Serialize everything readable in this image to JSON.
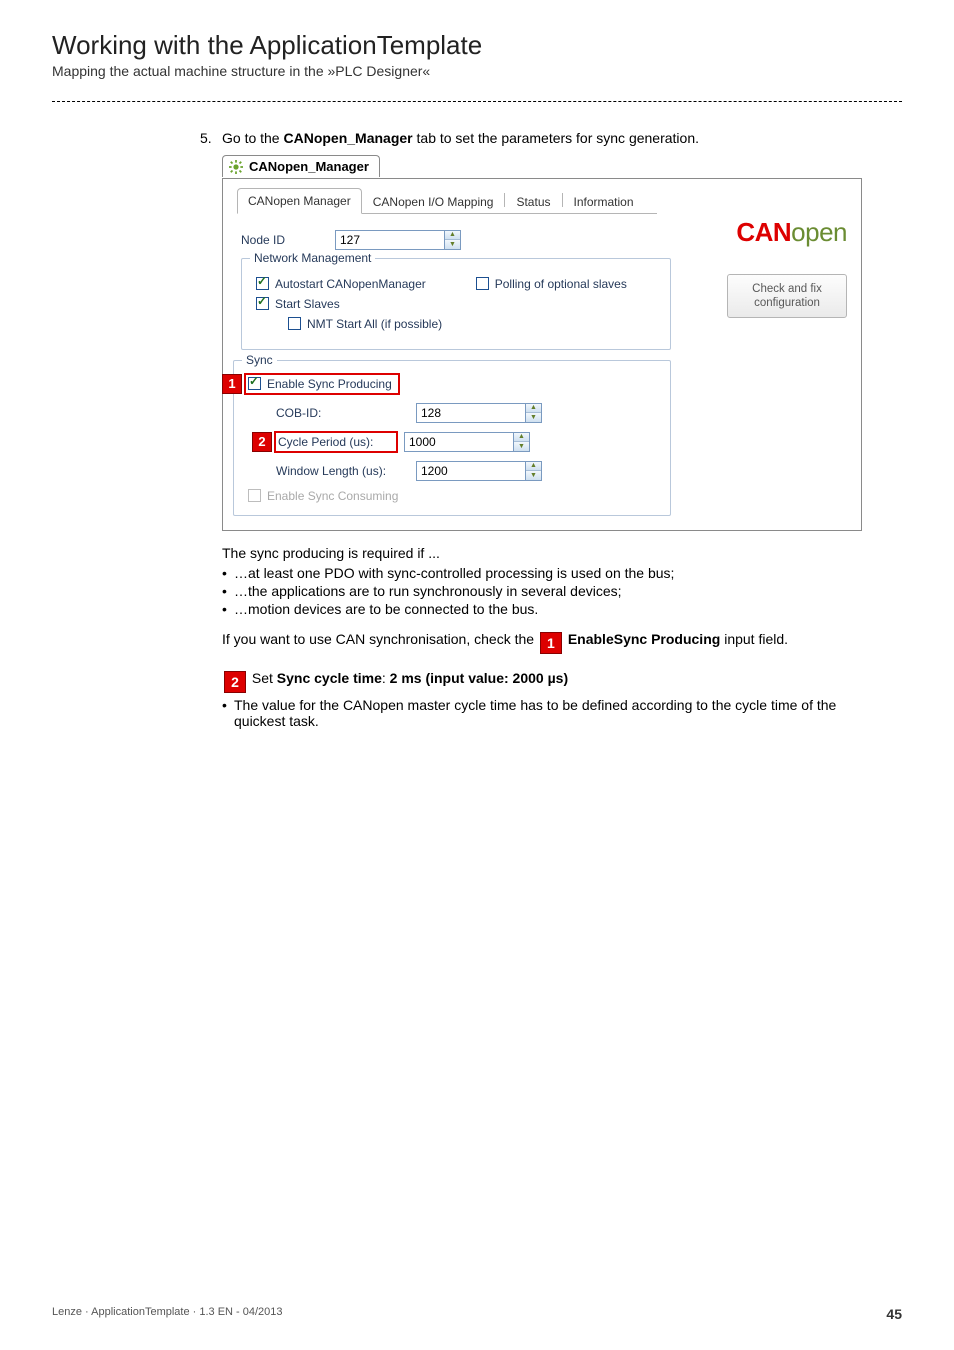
{
  "page": {
    "title": "Working with the ApplicationTemplate",
    "subtitle": "Mapping the actual machine structure in the »PLC Designer«"
  },
  "step": {
    "number": "5.",
    "text_pre": "Go to the ",
    "text_bold": "CANopen_Manager",
    "text_post": " tab to set the parameters for sync generation."
  },
  "tab_notch": "CANopen_Manager",
  "inner_tabs": {
    "t1": "CANopen Manager",
    "t2": "CANopen I/O Mapping",
    "t3": "Status",
    "t4": "Information"
  },
  "logo": {
    "bold": "CAN",
    "light": "open"
  },
  "checkfix": {
    "line1": "Check and fix",
    "line2": "configuration"
  },
  "form": {
    "nodeid_label": "Node ID",
    "nodeid_value": "127",
    "netmgmt_legend": "Network Management",
    "autostart_label": "Autostart CANopenManager",
    "polling_label": "Polling of optional slaves",
    "startslaves_label": "Start Slaves",
    "nmt_label": "NMT Start All (if possible)"
  },
  "sync": {
    "legend": "Sync",
    "enable_label": "Enable Sync Producing",
    "cob_label": "COB-ID:",
    "cob_value": "128",
    "cycle_label": "Cycle Period (us):",
    "cycle_value": "1000",
    "window_label": "Window Length (us):",
    "window_value": "1200",
    "consuming_label": "Enable Sync Consuming"
  },
  "markers": {
    "one": "1",
    "two": "2"
  },
  "bodytext": {
    "intro": "The sync producing is required if ...",
    "b1": "…at least one PDO with sync-controlled processing is used on the bus;",
    "b2": "…the applications are to run synchronously in several devices;",
    "b3": "…motion devices are to be connected to the bus.",
    "line2_pre": "If you want to use CAN synchronisation, check the ",
    "line2_bold": "EnableSync Producing",
    "line2_post": " input field.",
    "line3_pre": " Set ",
    "line3_b1": "Sync cycle time",
    "line3_mid": ": ",
    "line3_b2": "2 ms (input value: 2000 µs)",
    "sub1": "The value for the CANopen master cycle time has to be defined according to the cycle time of the quickest task."
  },
  "footer": {
    "left": "Lenze · ApplicationTemplate · 1.3 EN - 04/2013",
    "pagenum": "45"
  }
}
